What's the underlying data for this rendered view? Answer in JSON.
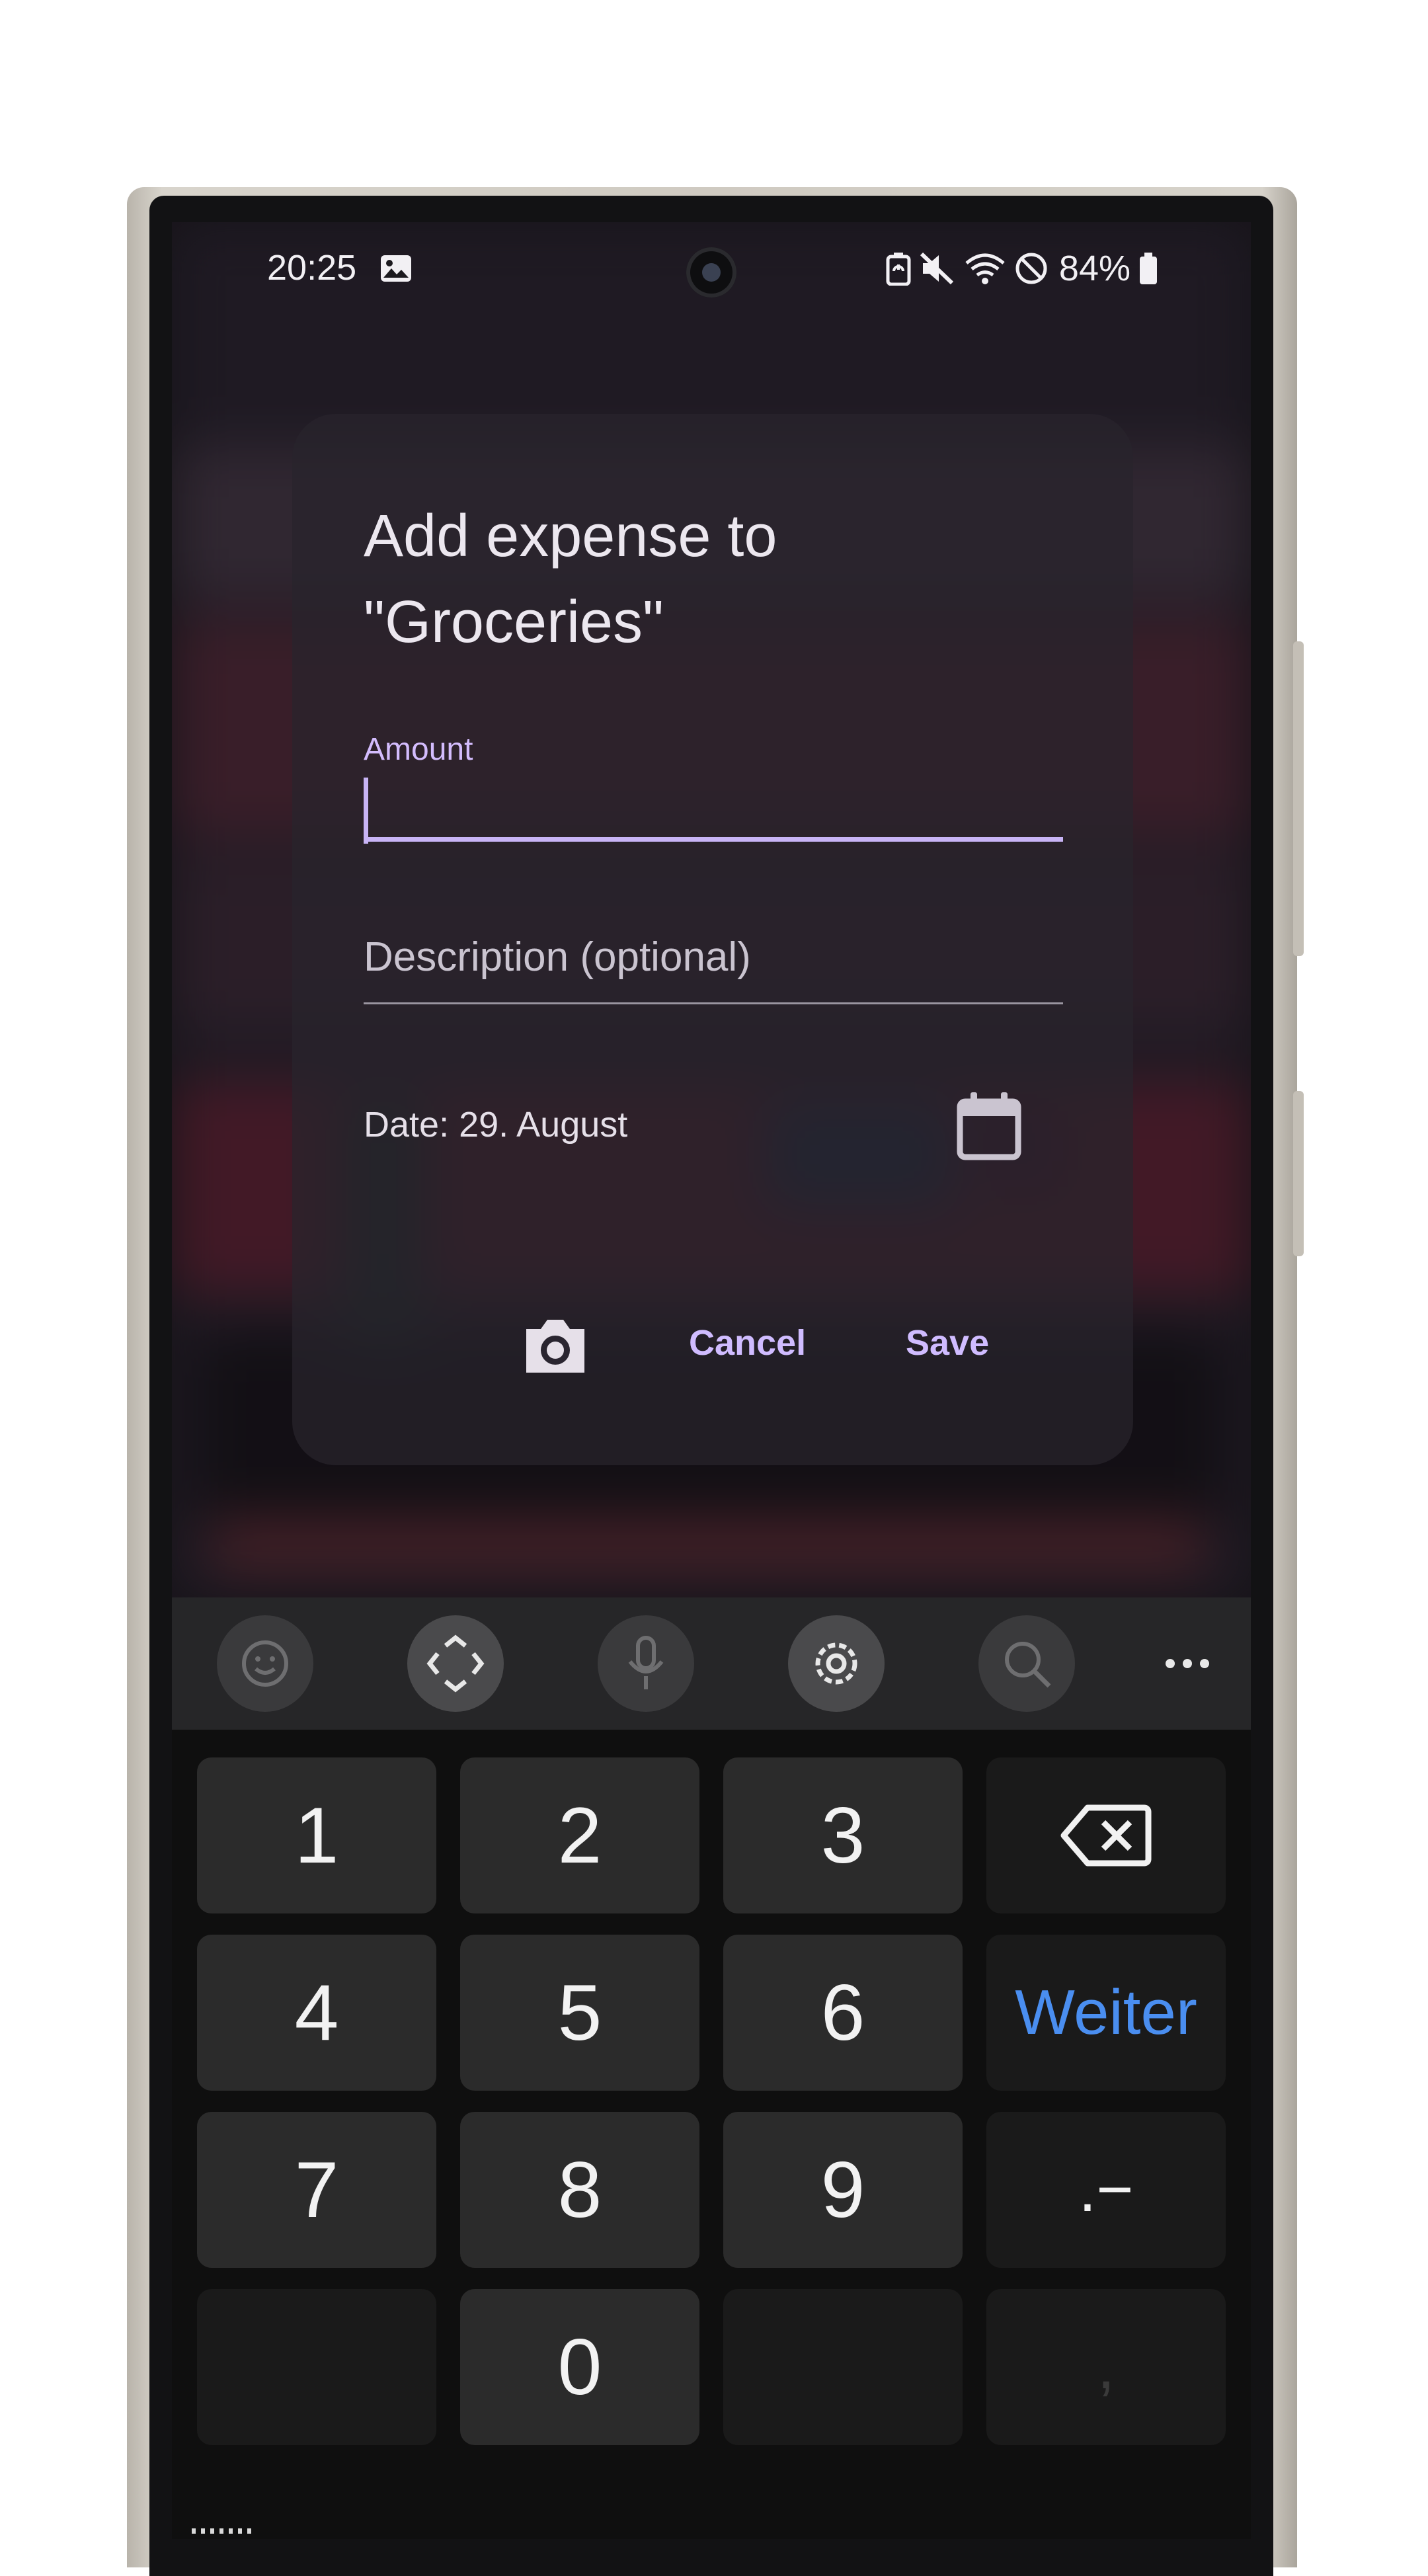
{
  "status_bar": {
    "time": "20:25",
    "battery": "84%",
    "icons": [
      "image-icon",
      "battery-saver-icon",
      "mute-icon",
      "wifi-icon",
      "do-not-disturb-icon",
      "battery-icon"
    ]
  },
  "dialog": {
    "title": "Add expense to \"Groceries\"",
    "amount": {
      "label": "Amount",
      "value": ""
    },
    "description": {
      "placeholder": "Description (optional)",
      "value": ""
    },
    "date_label": "Date: 29. August",
    "actions": {
      "cancel": "Cancel",
      "save": "Save"
    }
  },
  "keyboard": {
    "toolbar": [
      "emoji-icon",
      "cursor-move-icon",
      "microphone-icon",
      "settings-icon",
      "search-icon",
      "more-icon"
    ],
    "keys": {
      "k1": "1",
      "k2": "2",
      "k3": "3",
      "k4": "4",
      "k5": "5",
      "k6": "6",
      "next": "Weiter",
      "k7": "7",
      "k8": "8",
      "k9": "9",
      "dot_minus": ".−",
      "k0": "0",
      "comma": ","
    },
    "accent_color": "#4a8ef0"
  },
  "colors": {
    "primary": "#d0bcff",
    "dialog_text": "#ece7ef"
  }
}
